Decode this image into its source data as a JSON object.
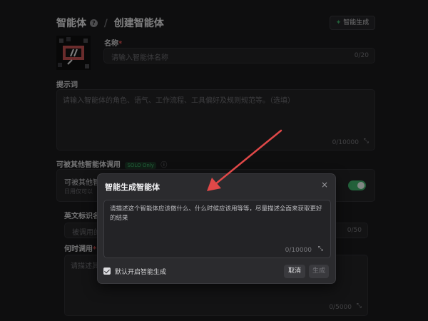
{
  "header": {
    "title": "智能体",
    "separator": "/",
    "subtitle": "创建智能体",
    "ai_button": "智能生成"
  },
  "form": {
    "name_label": "名称",
    "name_required": "*",
    "name_placeholder": "请输入智能体名称",
    "name_count": "0/20",
    "prompt_label": "提示词",
    "prompt_placeholder": "请输入智能体的角色、语气、工作流程、工具偏好及规则规范等。（选填）",
    "prompt_count": "0/10000",
    "callable_label": "可被其他智能体调用",
    "callable_badge": "SOLO Only",
    "callable_row_title": "可被其他智",
    "callable_row_desc": "日用仅可以",
    "english_id_label": "英文标识名",
    "english_id_placeholder": "被调用的",
    "english_id_count": "0/50",
    "when_label": "何时调用",
    "when_required": "*",
    "when_placeholder": "请描述其",
    "when_count": "0/5000"
  },
  "modal": {
    "title": "智能生成智能体",
    "close": "×",
    "textarea_text": "请描述这个智能体应该做什么、什么时候应该用等等，尽量描述全面来获取更好的结果",
    "count": "0/10000",
    "checkbox_label": "默认开启智能生成",
    "cancel": "取消",
    "generate": "生成"
  },
  "colors": {
    "background": "#1b1b1d",
    "modal": "#2b2b2e",
    "toggle_on": "#3fb06a",
    "arrow": "#e04848",
    "required": "#e05050"
  }
}
